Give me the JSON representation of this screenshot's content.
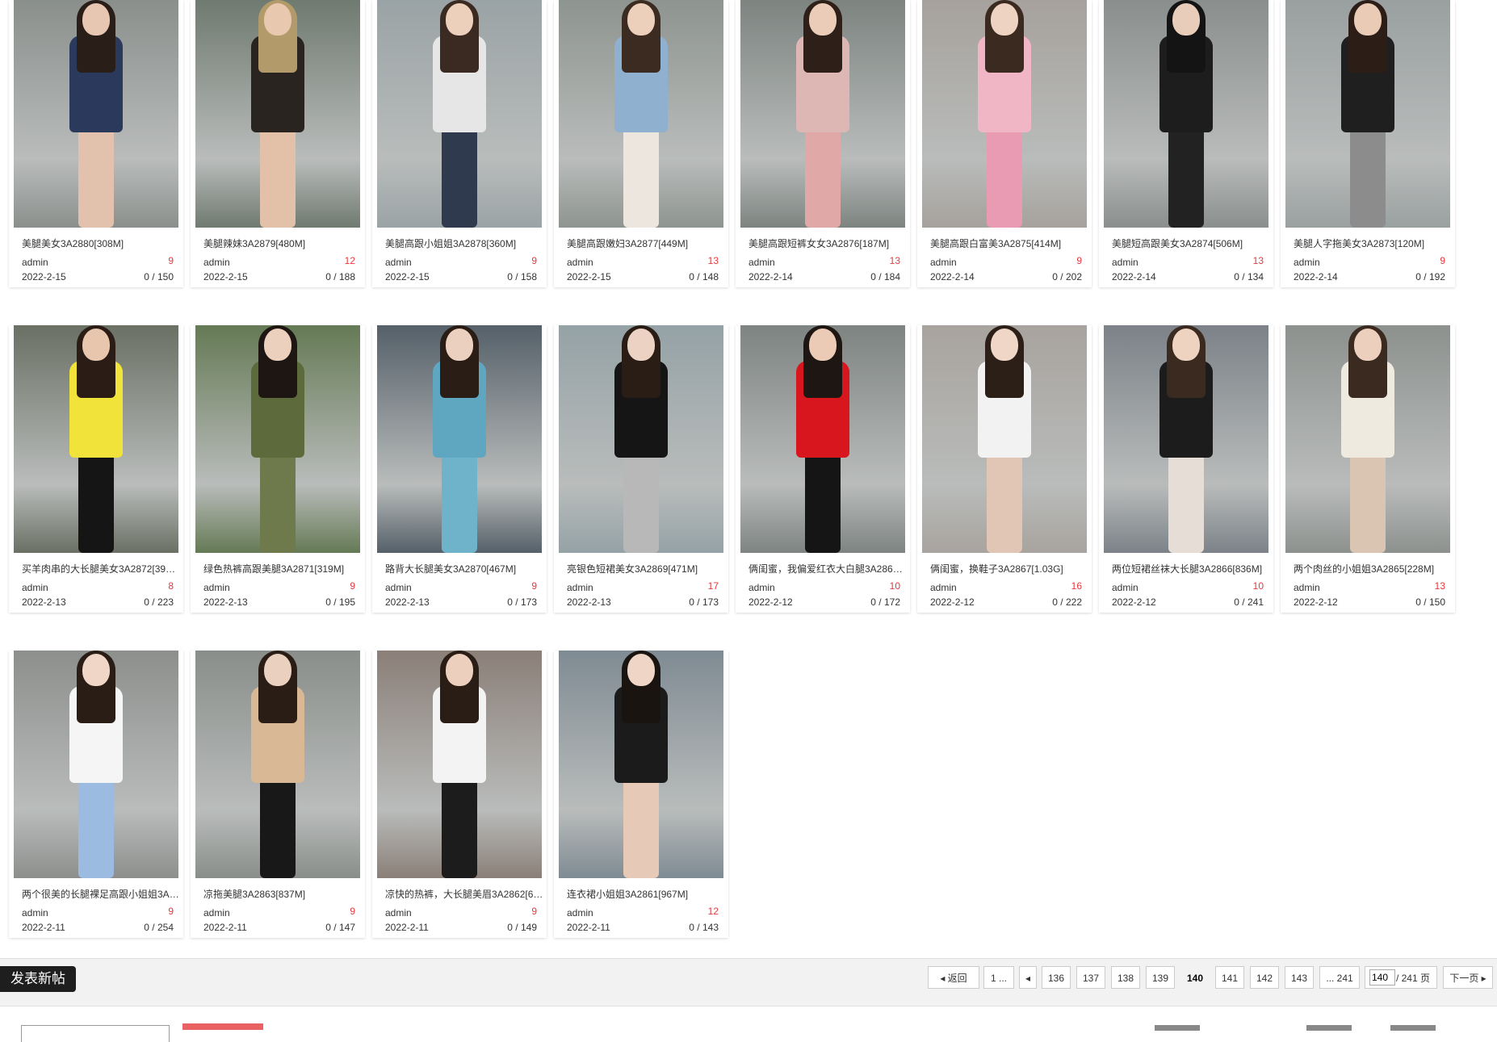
{
  "posts": [
    {
      "title": "美腿美女3A2880[308M]",
      "author": "admin",
      "count": "9",
      "date": "2022-2-15",
      "stats": "0 / 150"
    },
    {
      "title": "美腿辣妹3A2879[480M]",
      "author": "admin",
      "count": "12",
      "date": "2022-2-15",
      "stats": "0 / 188"
    },
    {
      "title": "美腿高跟小姐姐3A2878[360M]",
      "author": "admin",
      "count": "9",
      "date": "2022-2-15",
      "stats": "0 / 158"
    },
    {
      "title": "美腿高跟嫩妇3A2877[449M]",
      "author": "admin",
      "count": "13",
      "date": "2022-2-15",
      "stats": "0 / 148"
    },
    {
      "title": "美腿高跟短裤女女3A2876[187M]",
      "author": "admin",
      "count": "13",
      "date": "2022-2-14",
      "stats": "0 / 184"
    },
    {
      "title": "美腿高跟白富美3A2875[414M]",
      "author": "admin",
      "count": "9",
      "date": "2022-2-14",
      "stats": "0 / 202"
    },
    {
      "title": "美腿短高跟美女3A2874[506M]",
      "author": "admin",
      "count": "13",
      "date": "2022-2-14",
      "stats": "0 / 134"
    },
    {
      "title": "美腿人字拖美女3A2873[120M]",
      "author": "admin",
      "count": "9",
      "date": "2022-2-14",
      "stats": "0 / 192"
    },
    {
      "title": "买羊肉串的大长腿美女3A2872[393M]",
      "author": "admin",
      "count": "8",
      "date": "2022-2-13",
      "stats": "0 / 223"
    },
    {
      "title": "绿色热裤高跟美腿3A2871[319M]",
      "author": "admin",
      "count": "9",
      "date": "2022-2-13",
      "stats": "0 / 195"
    },
    {
      "title": "路背大长腿美女3A2870[467M]",
      "author": "admin",
      "count": "9",
      "date": "2022-2-13",
      "stats": "0 / 173"
    },
    {
      "title": "亮银色短裙美女3A2869[471M]",
      "author": "admin",
      "count": "17",
      "date": "2022-2-13",
      "stats": "0 / 173"
    },
    {
      "title": "俩闺蜜，我偏爱红衣大白腿3A2868[...",
      "author": "admin",
      "count": "10",
      "date": "2022-2-12",
      "stats": "0 / 172"
    },
    {
      "title": "俩闺蜜，换鞋子3A2867[1.03G]",
      "author": "admin",
      "count": "16",
      "date": "2022-2-12",
      "stats": "0 / 222"
    },
    {
      "title": "两位短裙丝袜大长腿3A2866[836M]",
      "author": "admin",
      "count": "10",
      "date": "2022-2-12",
      "stats": "0 / 241"
    },
    {
      "title": "两个肉丝的小姐姐3A2865[228M]",
      "author": "admin",
      "count": "13",
      "date": "2022-2-12",
      "stats": "0 / 150"
    },
    {
      "title": "两个很美的长腿裸足高跟小姐姐3A2...",
      "author": "admin",
      "count": "9",
      "date": "2022-2-11",
      "stats": "0 / 254"
    },
    {
      "title": "凉拖美腿3A2863[837M]",
      "author": "admin",
      "count": "9",
      "date": "2022-2-11",
      "stats": "0 / 147"
    },
    {
      "title": "凉快的热裤，大长腿美眉3A2862[64...",
      "author": "admin",
      "count": "9",
      "date": "2022-2-11",
      "stats": "0 / 149"
    },
    {
      "title": "连衣裙小姐姐3A2861[967M]",
      "author": "admin",
      "count": "12",
      "date": "2022-2-11",
      "stats": "0 / 143"
    }
  ],
  "photo_palettes": [
    {
      "bg": "#8a8f8c",
      "hair": "#2a1e18",
      "top": "#2b3a5c",
      "legs": "#e2c2ad",
      "skin": "#e8c7b2"
    },
    {
      "bg": "#6f7a70",
      "hair": "#b39a6a",
      "top": "#2a2420",
      "legs": "#e3c1a8",
      "skin": "#e9c8b0"
    },
    {
      "bg": "#9aa3a5",
      "hair": "#3a2a22",
      "top": "#e6e6e6",
      "legs": "#2f3a4e",
      "skin": "#ecd0bc"
    },
    {
      "bg": "#8e948f",
      "hair": "#3b2b20",
      "top": "#8fb0cf",
      "legs": "#ece6de",
      "skin": "#ecd0bc"
    },
    {
      "bg": "#7d8480",
      "hair": "#2e2019",
      "top": "#dcb7b4",
      "legs": "#e0a9a8",
      "skin": "#ebccb8"
    },
    {
      "bg": "#a6a19c",
      "hair": "#3a2a20",
      "top": "#f0b6c6",
      "legs": "#e99bb3",
      "skin": "#efd3c2"
    },
    {
      "bg": "#8a8e8c",
      "hair": "#141414",
      "top": "#1d1d1d",
      "legs": "#222",
      "skin": "#e9cdbb"
    },
    {
      "bg": "#9aa0a0",
      "hair": "#2c1e16",
      "top": "#1f1f1f",
      "legs": "#8c8c8c",
      "skin": "#e9cbb6"
    },
    {
      "bg": "#6a7064",
      "hair": "#2b1d16",
      "top": "#f2e33a",
      "legs": "#151515",
      "skin": "#e8c6ae"
    },
    {
      "bg": "#657a55",
      "hair": "#1e1612",
      "top": "#5d6a3c",
      "legs": "#6f7a4c",
      "skin": "#ecd0be"
    },
    {
      "bg": "#556069",
      "hair": "#2a1d16",
      "top": "#5fa7c1",
      "legs": "#6fb3cb",
      "skin": "#ecd0bf"
    },
    {
      "bg": "#95a2a6",
      "hair": "#2a1d16",
      "top": "#151515",
      "legs": "#b8b8b8",
      "skin": "#ecd2c2"
    },
    {
      "bg": "#7e8482",
      "hair": "#1e1612",
      "top": "#d7161d",
      "legs": "#151515",
      "skin": "#ebcbb6"
    },
    {
      "bg": "#a8a39e",
      "hair": "#2b1f18",
      "top": "#f2f2f2",
      "legs": "#e2c6b5",
      "skin": "#efd6c6"
    },
    {
      "bg": "#7c8288",
      "hair": "#3a2a20",
      "top": "#1c1c1c",
      "legs": "#e6ddd6",
      "skin": "#eed3c1"
    },
    {
      "bg": "#8d918e",
      "hair": "#3b2a20",
      "top": "#efeadf",
      "legs": "#d9c5b2",
      "skin": "#ecd0bd"
    },
    {
      "bg": "#8c8f8c",
      "hair": "#2a1d16",
      "top": "#f5f5f5",
      "legs": "#9cbbe0",
      "skin": "#efd6c6"
    },
    {
      "bg": "#8a8e8a",
      "hair": "#2a1d16",
      "top": "#d9b896",
      "legs": "#181818",
      "skin": "#ead0be"
    },
    {
      "bg": "#8b7f78",
      "hair": "#2a1d16",
      "top": "#f3f3f3",
      "legs": "#1c1c1c",
      "skin": "#ecd0bd"
    },
    {
      "bg": "#7f8b93",
      "hair": "#1a1410",
      "top": "#1b1b1b",
      "legs": "#e6c9b7",
      "skin": "#eed5c5"
    }
  ],
  "toolbar": {
    "new_post_label": "发表新帖"
  },
  "pagination": {
    "back_label": "返回",
    "first_label": "1 ...",
    "prev_symbol": "◂",
    "pages": [
      "136",
      "137",
      "138",
      "139",
      "140",
      "141",
      "142",
      "143"
    ],
    "current": "140",
    "last_label": "... 241",
    "input_value": "140",
    "total_label": "/ 241 页",
    "next_label": "下一页"
  }
}
